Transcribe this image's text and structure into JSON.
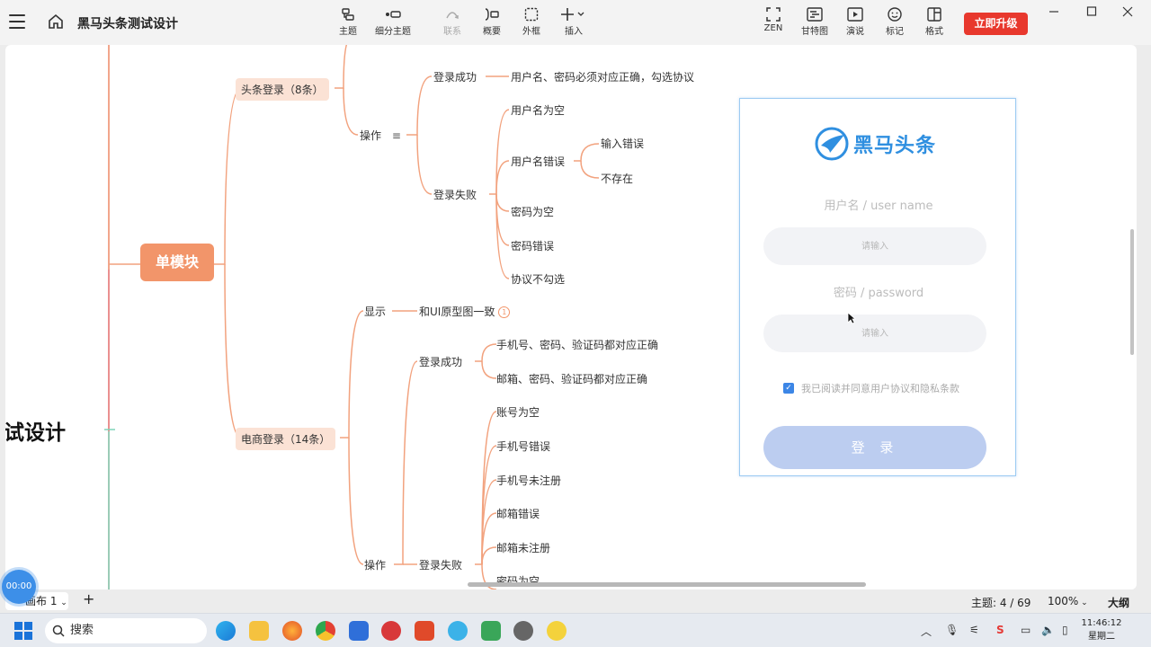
{
  "app": {
    "title": "黑马头条测试设计"
  },
  "toolbar": {
    "items": [
      {
        "label": "主题",
        "icon": "topic-icon"
      },
      {
        "label": "细分主题",
        "icon": "subtopic-icon"
      },
      {
        "label": "联系",
        "icon": "relationship-icon",
        "disabled": true
      },
      {
        "label": "概要",
        "icon": "summary-icon"
      },
      {
        "label": "外框",
        "icon": "boundary-icon"
      },
      {
        "label": "插入",
        "icon": "insert-icon"
      }
    ],
    "right_items": [
      {
        "label": "ZEN",
        "icon": "zen-icon"
      },
      {
        "label": "甘特图",
        "icon": "gantt-icon"
      },
      {
        "label": "演说",
        "icon": "pitch-icon"
      },
      {
        "label": "标记",
        "icon": "marker-icon"
      },
      {
        "label": "格式",
        "icon": "format-icon"
      }
    ],
    "upgrade_label": "立即升级"
  },
  "mindmap": {
    "root_label": "单模块",
    "central_partial": "试设计",
    "branch1": {
      "label": "头条登录（8条）",
      "ops_label": "操作",
      "success_label": "登录成功",
      "success_detail": "用户名、密码必须对应正确，勾选协议",
      "fail_label": "登录失败",
      "fail_items": [
        "用户名为空",
        "用户名错误",
        "密码为空",
        "密码错误",
        "协议不勾选"
      ],
      "username_error_children": [
        "输入错误",
        "不存在"
      ]
    },
    "branch2": {
      "label": "电商登录（14条）",
      "display_label": "显示",
      "display_detail": "和UI原型图一致",
      "badge": "1",
      "ops_label": "操作",
      "success_label": "登录成功",
      "success_items": [
        "手机号、密码、验证码都对应正确",
        "邮箱、密码、验证码都对应正确"
      ],
      "fail_label": "登录失败",
      "fail_items": [
        "账号为空",
        "手机号错误",
        "手机号未注册",
        "邮箱错误",
        "邮箱未注册",
        "密码为空"
      ]
    }
  },
  "login_card": {
    "brand": "黑马头条",
    "username_label": "用户名 / user name",
    "username_placeholder": "请输入",
    "password_label": "密码 / password",
    "password_placeholder": "请输入",
    "agreement": "我已阅读并同意用户协议和隐私条款",
    "agreement_checked": true,
    "login_button": "登 录",
    "accent": "#2f8fe0"
  },
  "statusbar": {
    "sheet_tab": "画布 1",
    "topic_count": "主题: 4 / 69",
    "zoom": "100%",
    "outline": "大纲",
    "timer": "00:00"
  },
  "taskbar": {
    "search_placeholder": "搜索",
    "time": "11:46:12",
    "day": "星期二"
  }
}
